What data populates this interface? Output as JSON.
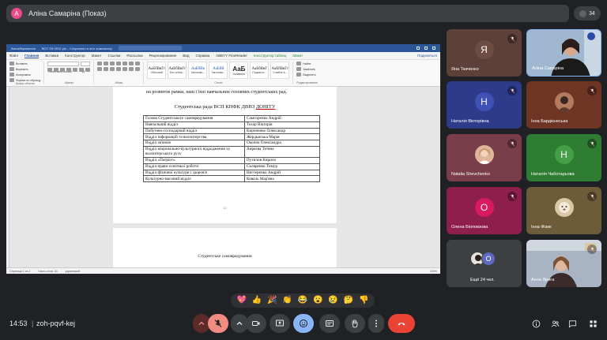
{
  "presenting": {
    "avatar_letter": "А",
    "title": "Аліна Самаріна (Показ)"
  },
  "people_count": "34",
  "word": {
    "title_bar": {
      "autosave": "Автозбереження",
      "doc_title": "ВСП ЗФ 2022 рік – Сохранено в этот компьютер"
    },
    "tabs": [
      "Файл",
      "Главная",
      "Вставка",
      "Конструктор",
      "Макет",
      "Ссылки",
      "Рассылки",
      "Рецензирование",
      "Вид",
      "Справка",
      "ABBYY FineReader",
      "Конструктор таблиц",
      "Макет"
    ],
    "active_tab": "Главная",
    "share_label": "Поделиться",
    "clipboard": {
      "paste": "Вставить",
      "cut": "Вырезать",
      "copy": "Копировать",
      "format": "Формат по образцу",
      "group": "Буфер обмена"
    },
    "font": {
      "name": "Times New Roman",
      "size": "14",
      "group": "Шрифт"
    },
    "paragraph_group": "Абзац",
    "styles": [
      {
        "sample": "АаБбВвГг",
        "name": "Обычный"
      },
      {
        "sample": "АаБбВвГг",
        "name": "Без интер..."
      },
      {
        "sample": "АаБбВв",
        "name": "Заголово..."
      },
      {
        "sample": "АаБбВ",
        "name": "Заголово..."
      },
      {
        "sample": "АаБ",
        "name": "Название"
      },
      {
        "sample": "АаБбВвГ",
        "name": "Подзагол..."
      },
      {
        "sample": "АаБбВвГг",
        "name": "Слабое в..."
      }
    ],
    "styles_group": "Стили",
    "editing": {
      "find": "Найти",
      "replace": "Заменить",
      "select": "Выделить",
      "group": "Редактирование"
    },
    "doc_line": "на розвиток рамки, наш і їхні навчальних головних студентських рад.",
    "doc_heading_pre": "Студентська рада ВСП КНФК ДВНЗ ",
    "doc_heading_u": "ДОНІТУ",
    "table": [
      [
        "Голова Студентського самоврядування",
        "Самсоренко Андрій"
      ],
      [
        "Навчальний відділ",
        "Тохар Вікторія"
      ],
      [
        "Побутово-господарчий відділ",
        "Кириченко Олександр"
      ],
      [
        "Відділ інформацій та волонтерства",
        "Жердьмська Марія"
      ],
      [
        "Відділ зв'язків",
        "Окопна Олександра"
      ],
      [
        "Відділ національно-культурного відродження та волонтерського руху",
        "Анреєва Тетяна"
      ],
      [
        "Відділ «Патріот»",
        "Путилов Кирило"
      ],
      [
        "Відділ право-освітньої роботи",
        "Скляренко Тимур"
      ],
      [
        "Відділ фізичної культури і здоров'я",
        "Нестеренко Андрій"
      ],
      [
        "Культурно-масовий відділ",
        "Коваль Мар'яна"
      ]
    ],
    "page_num": "1/2",
    "page2_text": "Студентське самоврядування",
    "status": {
      "page": "Страница 1 из 2",
      "words": "Число слов: 34",
      "lang": "украинский",
      "zoom": "100%"
    }
  },
  "participants": [
    {
      "name": "Яна Ткаченко",
      "letter": "Я",
      "bg": "#5d4037",
      "av_bg": "#6d4c41",
      "muted": true
    },
    {
      "name": "Аліна Самаріна",
      "letter": "",
      "bg": "#8faac3",
      "av_bg": "",
      "muted": false
    },
    {
      "name": "Наталія Вікторівна",
      "letter": "Н",
      "bg": "#2d3b8a",
      "av_bg": "#3f51b5",
      "muted": true
    },
    {
      "name": "Інна Бардієнеська",
      "letter": "",
      "bg": "#6e3424",
      "av_bg": "#b37a5c",
      "muted": true
    },
    {
      "name": "Natalia Shevchenko",
      "letter": "",
      "bg": "#7a3e4a",
      "av_bg": "#e0b49a",
      "muted": true
    },
    {
      "name": "Наталія Чаботарьова",
      "letter": "Н",
      "bg": "#2e7d32",
      "av_bg": "#43a047",
      "muted": true
    },
    {
      "name": "Олена Біоповзова",
      "letter": "О",
      "bg": "#8e1f4d",
      "av_bg": "#d81b60",
      "muted": true
    },
    {
      "name": "Інна Фізик",
      "letter": "",
      "bg": "#6d5b3a",
      "av_bg": "#d9c8a6",
      "muted": true
    },
    {
      "name": "Ещё 24 чел.",
      "letter": "О",
      "bg": "#3c4043",
      "av_bg": "#5c6bc0",
      "muted": false
    },
    {
      "name": "Анна Ярига",
      "letter": "",
      "bg": "#a8b4c4",
      "av_bg": "",
      "muted": true
    }
  ],
  "reactions": [
    "💖",
    "👍",
    "🎉",
    "👏",
    "😂",
    "😮",
    "😢",
    "🤔",
    "👎"
  ],
  "meeting": {
    "time": "14:53",
    "separator": "|",
    "code": "zoh-pqvf-kej"
  },
  "colors": {
    "end_call": "#ea4335",
    "muted_bg": "#f28b82",
    "raise_bg": "#8ab4f8"
  }
}
